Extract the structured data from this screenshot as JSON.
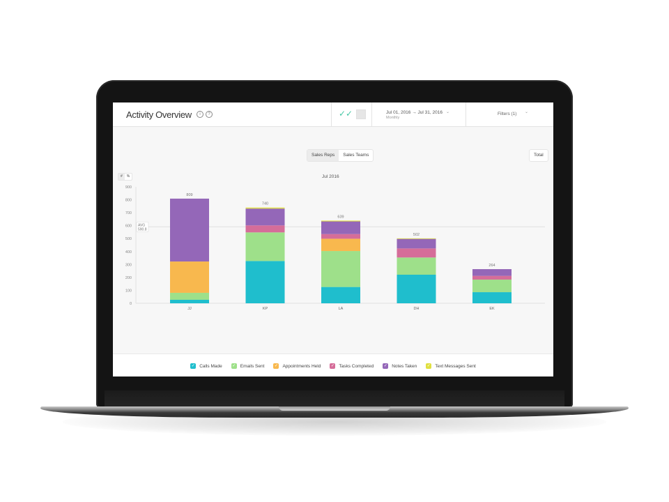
{
  "header": {
    "title": "Activity Overview",
    "info_icon": "ⓘ",
    "help_icon": "?",
    "view_icon": "double-check-icon",
    "grid_icon": "grid-icon",
    "date_range": "Jul 01, 2016 → Jul 31, 2016",
    "date_granularity": "Monthly",
    "filters_label": "Filters (1)",
    "chevron": "⌄"
  },
  "toolbar": {
    "tabs": [
      {
        "label": "Sales Reps",
        "active": true
      },
      {
        "label": "Sales Teams",
        "active": false
      }
    ],
    "total_label": "Total",
    "unit_toggle": [
      {
        "label": "#",
        "active": true
      },
      {
        "label": "%",
        "active": false
      }
    ]
  },
  "chart_data": {
    "type": "bar",
    "stacked": true,
    "title": "Jul 2016",
    "categories": [
      "JJ",
      "KP",
      "LA",
      "DH",
      "EK"
    ],
    "totals": [
      809,
      740,
      639,
      502,
      264
    ],
    "series": [
      {
        "name": "Calls Made",
        "color": "#1fbecd",
        "values": [
          27,
          327,
          126,
          221,
          86
        ]
      },
      {
        "name": "Emails Sent",
        "color": "#9ee08a",
        "values": [
          54,
          221,
          278,
          133,
          97
        ]
      },
      {
        "name": "Appointments Held",
        "color": "#f8b84e",
        "values": [
          242,
          0,
          95,
          0,
          0
        ]
      },
      {
        "name": "Tasks Completed",
        "color": "#d56d99",
        "values": [
          0,
          54,
          36,
          70,
          29
        ]
      },
      {
        "name": "Notes Taken",
        "color": "#9467b8",
        "values": [
          486,
          130,
          98,
          74,
          52
        ]
      },
      {
        "name": "Text Messages Sent",
        "color": "#e0e040",
        "values": [
          0,
          8,
          6,
          4,
          0
        ]
      }
    ],
    "average": {
      "label": "AVG",
      "value": "590.8"
    },
    "ylim": [
      0,
      900
    ],
    "yticks": [
      0,
      100,
      200,
      300,
      400,
      500,
      600,
      700,
      800,
      900
    ],
    "xlabel": "",
    "ylabel": "",
    "grid": false,
    "legend_position": "bottom"
  },
  "legend_check": "✓"
}
